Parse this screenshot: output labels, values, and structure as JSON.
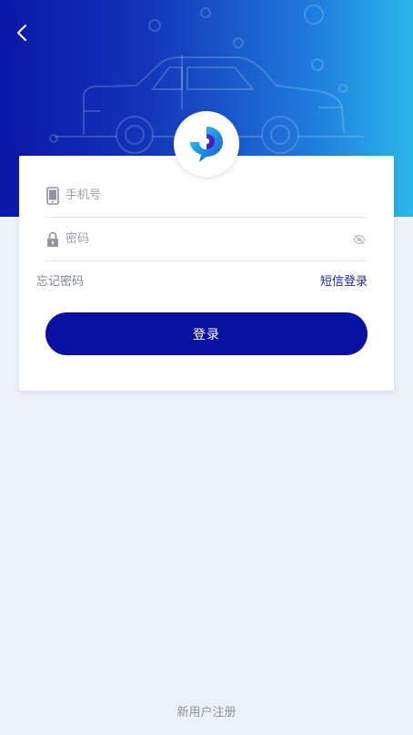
{
  "header": {
    "back_icon": "chevron-left-icon",
    "gradient_start": "#0a17a8",
    "gradient_end": "#2bb6ea"
  },
  "logo": {
    "icon": "app-logo-icon"
  },
  "login_form": {
    "phone_placeholder": "手机号",
    "password_placeholder": "密码",
    "phone_icon": "phone-icon",
    "lock_icon": "lock-icon",
    "visibility_icon": "eye-off-icon",
    "forgot_password": "忘记密码",
    "sms_login": "短信登录",
    "login_button": "登录",
    "accent_color": "#0a11a0"
  },
  "footer": {
    "register": "新用户注册"
  }
}
